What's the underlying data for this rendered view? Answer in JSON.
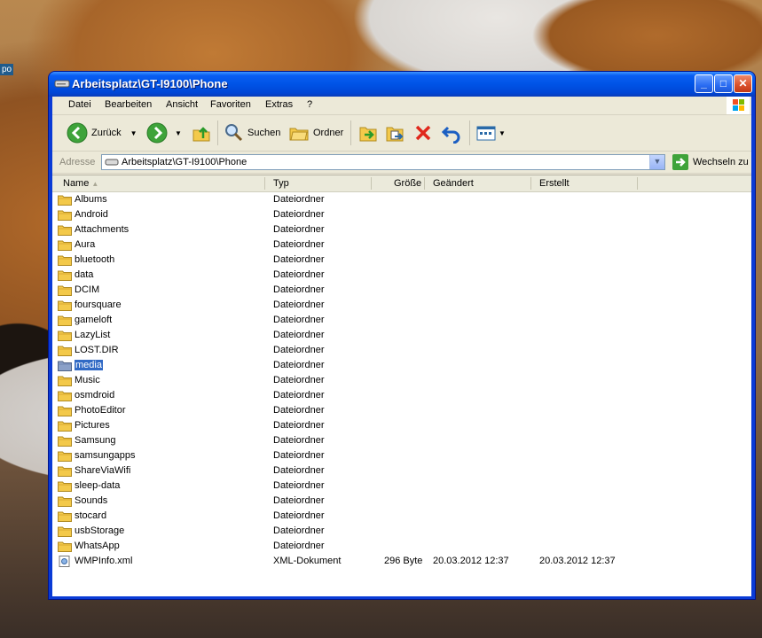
{
  "desktop": {
    "icon_label": "po"
  },
  "window": {
    "title": "Arbeitsplatz\\GT-I9100\\Phone",
    "controls": {
      "minimize": "_",
      "maximize": "□",
      "close": "✕"
    }
  },
  "menu": [
    "Datei",
    "Bearbeiten",
    "Ansicht",
    "Favoriten",
    "Extras",
    "?"
  ],
  "toolbar": {
    "back_label": "Zurück",
    "search_label": "Suchen",
    "folders_label": "Ordner"
  },
  "address": {
    "label": "Adresse",
    "value": "Arbeitsplatz\\GT-I9100\\Phone",
    "go_label": "Wechseln zu"
  },
  "columns": {
    "name": "Name",
    "type": "Typ",
    "size": "Größe",
    "modified": "Geändert",
    "created": "Erstellt"
  },
  "files": [
    {
      "name": "Albums",
      "type": "Dateiordner",
      "size": "",
      "modified": "",
      "created": ""
    },
    {
      "name": "Android",
      "type": "Dateiordner",
      "size": "",
      "modified": "",
      "created": ""
    },
    {
      "name": "Attachments",
      "type": "Dateiordner",
      "size": "",
      "modified": "",
      "created": ""
    },
    {
      "name": "Aura",
      "type": "Dateiordner",
      "size": "",
      "modified": "",
      "created": ""
    },
    {
      "name": "bluetooth",
      "type": "Dateiordner",
      "size": "",
      "modified": "",
      "created": ""
    },
    {
      "name": "data",
      "type": "Dateiordner",
      "size": "",
      "modified": "",
      "created": ""
    },
    {
      "name": "DCIM",
      "type": "Dateiordner",
      "size": "",
      "modified": "",
      "created": ""
    },
    {
      "name": "foursquare",
      "type": "Dateiordner",
      "size": "",
      "modified": "",
      "created": ""
    },
    {
      "name": "gameloft",
      "type": "Dateiordner",
      "size": "",
      "modified": "",
      "created": ""
    },
    {
      "name": "LazyList",
      "type": "Dateiordner",
      "size": "",
      "modified": "",
      "created": ""
    },
    {
      "name": "LOST.DIR",
      "type": "Dateiordner",
      "size": "",
      "modified": "",
      "created": ""
    },
    {
      "name": "media",
      "type": "Dateiordner",
      "size": "",
      "modified": "",
      "created": "",
      "selected": true
    },
    {
      "name": "Music",
      "type": "Dateiordner",
      "size": "",
      "modified": "",
      "created": ""
    },
    {
      "name": "osmdroid",
      "type": "Dateiordner",
      "size": "",
      "modified": "",
      "created": ""
    },
    {
      "name": "PhotoEditor",
      "type": "Dateiordner",
      "size": "",
      "modified": "",
      "created": ""
    },
    {
      "name": "Pictures",
      "type": "Dateiordner",
      "size": "",
      "modified": "",
      "created": ""
    },
    {
      "name": "Samsung",
      "type": "Dateiordner",
      "size": "",
      "modified": "",
      "created": ""
    },
    {
      "name": "samsungapps",
      "type": "Dateiordner",
      "size": "",
      "modified": "",
      "created": ""
    },
    {
      "name": "ShareViaWifi",
      "type": "Dateiordner",
      "size": "",
      "modified": "",
      "created": ""
    },
    {
      "name": "sleep-data",
      "type": "Dateiordner",
      "size": "",
      "modified": "",
      "created": ""
    },
    {
      "name": "Sounds",
      "type": "Dateiordner",
      "size": "",
      "modified": "",
      "created": ""
    },
    {
      "name": "stocard",
      "type": "Dateiordner",
      "size": "",
      "modified": "",
      "created": ""
    },
    {
      "name": "usbStorage",
      "type": "Dateiordner",
      "size": "",
      "modified": "",
      "created": ""
    },
    {
      "name": "WhatsApp",
      "type": "Dateiordner",
      "size": "",
      "modified": "",
      "created": ""
    },
    {
      "name": "WMPInfo.xml",
      "type": "XML-Dokument",
      "size": "296 Byte",
      "modified": "20.03.2012 12:37",
      "created": "20.03.2012 12:37",
      "icon": "xml-file-icon"
    }
  ],
  "colors": {
    "title_blue": "#0053e6",
    "selection": "#316ac5",
    "folder": "#f3c94a"
  }
}
